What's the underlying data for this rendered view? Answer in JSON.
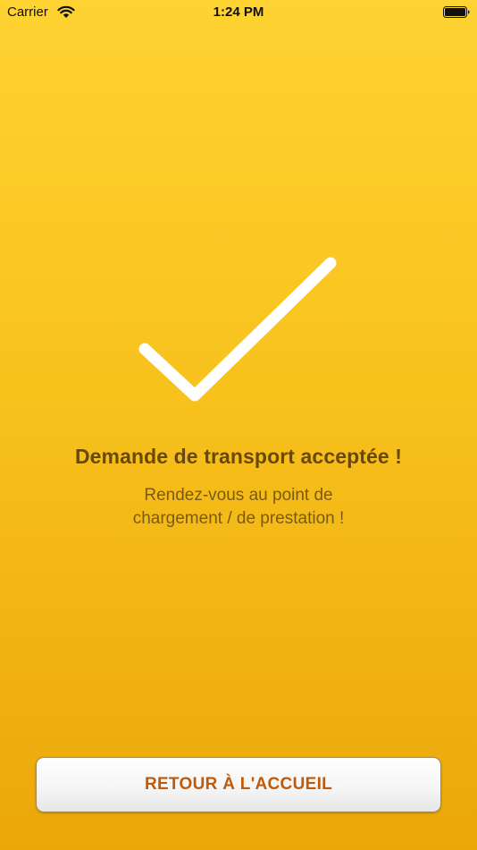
{
  "status_bar": {
    "carrier": "Carrier",
    "time": "1:24 PM",
    "wifi_icon": "wifi-icon",
    "battery_icon": "battery-full-icon"
  },
  "confirmation": {
    "icon": "checkmark-icon",
    "title": "Demande de transport acceptée !",
    "subtitle_line1": "Rendez-vous au point de",
    "subtitle_line2": "chargement / de prestation !"
  },
  "actions": {
    "home_button_label": "RETOUR À L'ACCUEIL"
  },
  "colors": {
    "background_top": "#fed332",
    "background_bottom": "#eba70a",
    "title": "#6a4806",
    "button_text": "#c05a0a"
  }
}
